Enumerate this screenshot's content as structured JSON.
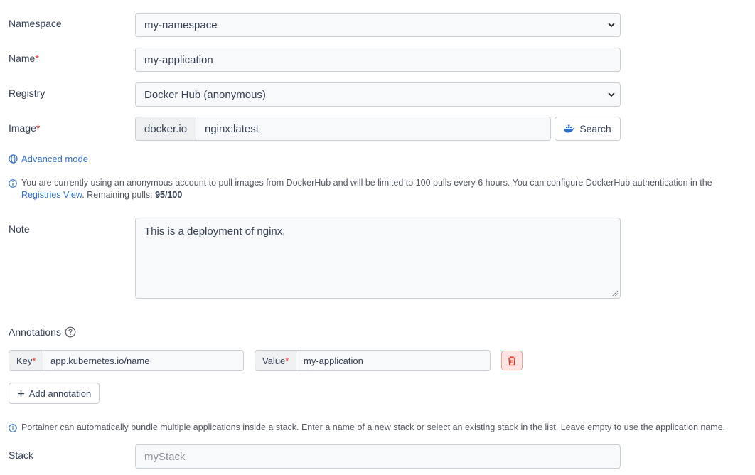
{
  "namespace": {
    "label": "Namespace",
    "value": "my-namespace"
  },
  "name": {
    "label": "Name",
    "required_mark": "*",
    "value": "my-application"
  },
  "registry": {
    "label": "Registry",
    "value": "Docker Hub (anonymous)"
  },
  "image": {
    "label": "Image",
    "required_mark": "*",
    "prefix": "docker.io",
    "value": "nginx:latest",
    "search_label": "Search"
  },
  "advanced_mode": {
    "label": "Advanced mode"
  },
  "dockerhub_info": {
    "text_before": "You are currently using an anonymous account to pull images from DockerHub and will be limited to 100 pulls every 6 hours. You can configure DockerHub authentication in the",
    "link": "Registries View",
    "text_after": ". Remaining pulls:",
    "remaining": "95/100"
  },
  "note": {
    "label": "Note",
    "value": "This is a deployment of nginx."
  },
  "annotations": {
    "label": "Annotations",
    "key_label": "Key",
    "key_required": "*",
    "key_value": "app.kubernetes.io/name",
    "value_label": "Value",
    "value_required": "*",
    "value_value": "my-application",
    "add_label": "Add annotation"
  },
  "stack_info": {
    "text": "Portainer can automatically bundle multiple applications inside a stack. Enter a name of a new stack or select an existing stack in the list. Leave empty to use the application name."
  },
  "stack": {
    "label": "Stack",
    "placeholder": "myStack"
  },
  "colors": {
    "accent": "#3171c6",
    "danger": "#d92d20",
    "danger_bg": "#fde4e2"
  }
}
